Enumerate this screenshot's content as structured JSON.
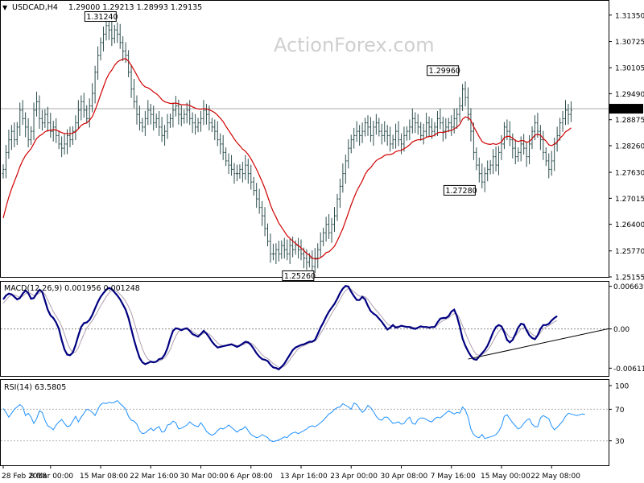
{
  "header": {
    "symbol": "USDCAD,H4",
    "ohlc": "1.29000 1.29213 1.28993 1.29135"
  },
  "watermark": "ActionForex.com",
  "price_panel": {
    "current_price_label": "1.29135",
    "current_price": 1.29135,
    "ylim": [
      1.25155,
      1.3165
    ],
    "y_ticks": [
      {
        "label": "1.31350",
        "value": 1.3135
      },
      {
        "label": "1.30725",
        "value": 1.30725
      },
      {
        "label": "1.30105",
        "value": 1.30105
      },
      {
        "label": "1.29490",
        "value": 1.2949
      },
      {
        "label": "1.28875",
        "value": 1.28875
      },
      {
        "label": "1.28260",
        "value": 1.2826
      },
      {
        "label": "1.27630",
        "value": 1.2763
      },
      {
        "label": "1.27015",
        "value": 1.27015
      },
      {
        "label": "1.26400",
        "value": 1.264
      },
      {
        "label": "1.25770",
        "value": 1.2577
      },
      {
        "label": "1.25155",
        "value": 1.25155
      }
    ],
    "annotations": [
      {
        "label": "1.31240",
        "value": 1.3124,
        "bar": 40,
        "anchor": "high"
      },
      {
        "label": "1.29960",
        "value": 1.2996,
        "bar": 163,
        "anchor": "high"
      },
      {
        "label": "1.27280",
        "value": 1.2728,
        "bar": 169,
        "anchor": "low"
      },
      {
        "label": "1.25260",
        "value": 1.2526,
        "bar": 111,
        "anchor": "low"
      }
    ],
    "close_series": [
      1.277,
      1.281,
      1.284,
      1.286,
      1.284,
      1.287,
      1.291,
      1.289,
      1.287,
      1.284,
      1.286,
      1.291,
      1.293,
      1.289,
      1.288,
      1.29,
      1.288,
      1.286,
      1.287,
      1.285,
      1.283,
      1.282,
      1.283,
      1.285,
      1.284,
      1.286,
      1.288,
      1.291,
      1.293,
      1.291,
      1.289,
      1.292,
      1.295,
      1.3,
      1.304,
      1.307,
      1.309,
      1.311,
      1.31,
      1.308,
      1.31,
      1.309,
      1.307,
      1.305,
      1.304,
      1.3,
      1.296,
      1.293,
      1.29,
      1.288,
      1.287,
      1.289,
      1.291,
      1.29,
      1.288,
      1.289,
      1.287,
      1.285,
      1.286,
      1.288,
      1.289,
      1.291,
      1.292,
      1.29,
      1.289,
      1.29,
      1.291,
      1.289,
      1.288,
      1.287,
      1.288,
      1.289,
      1.291,
      1.29,
      1.288,
      1.287,
      1.286,
      1.284,
      1.283,
      1.281,
      1.279,
      1.278,
      1.277,
      1.276,
      1.276,
      1.277,
      1.276,
      1.278,
      1.276,
      1.274,
      1.272,
      1.27,
      1.268,
      1.266,
      1.263,
      1.26,
      1.257,
      1.257,
      1.258,
      1.257,
      1.259,
      1.258,
      1.257,
      1.259,
      1.258,
      1.259,
      1.258,
      1.257,
      1.256,
      1.255,
      1.256,
      1.254,
      1.256,
      1.258,
      1.26,
      1.262,
      1.264,
      1.262,
      1.264,
      1.266,
      1.27,
      1.273,
      1.276,
      1.279,
      1.282,
      1.284,
      1.285,
      1.286,
      1.285,
      1.286,
      1.288,
      1.287,
      1.285,
      1.287,
      1.288,
      1.286,
      1.285,
      1.286,
      1.285,
      1.283,
      1.284,
      1.286,
      1.284,
      1.283,
      1.285,
      1.286,
      1.287,
      1.289,
      1.288,
      1.287,
      1.285,
      1.286,
      1.288,
      1.287,
      1.286,
      1.287,
      1.289,
      1.288,
      1.286,
      1.287,
      1.288,
      1.287,
      1.289,
      1.29,
      1.292,
      1.296,
      1.294,
      1.29,
      1.286,
      1.281,
      1.278,
      1.276,
      1.274,
      1.276,
      1.277,
      1.278,
      1.28,
      1.278,
      1.281,
      1.283,
      1.287,
      1.286,
      1.284,
      1.282,
      1.28,
      1.281,
      1.283,
      1.282,
      1.28,
      1.283,
      1.286,
      1.288,
      1.286,
      1.284,
      1.281,
      1.279,
      1.277,
      1.279,
      1.283,
      1.285,
      1.288,
      1.289,
      1.291,
      1.29,
      1.291
    ],
    "ma_series": [
      1.2655,
      1.2681,
      1.2704,
      1.2724,
      1.2741,
      1.2758,
      1.2776,
      1.2791,
      1.2803,
      1.2811,
      1.2819,
      1.2831,
      1.2843,
      1.2849,
      1.2853,
      1.2859,
      1.2862,
      1.2862,
      1.2864,
      1.2863,
      1.286,
      1.2857,
      1.2855,
      1.2855,
      1.2854,
      1.2856,
      1.2859,
      1.2866,
      1.2874,
      1.2878,
      1.288,
      1.2886,
      1.2895,
      1.291,
      1.2928,
      1.2947,
      1.2965,
      1.2983,
      1.2996,
      1.3005,
      1.3016,
      1.3024,
      1.3028,
      1.3031,
      1.3032,
      1.3026,
      1.3016,
      1.3005,
      1.2993,
      1.2981,
      1.2971,
      1.2965,
      1.2963,
      1.2959,
      1.2953,
      1.2949,
      1.2943,
      1.2935,
      1.293,
      1.2928,
      1.2926,
      1.2926,
      1.2927,
      1.2925,
      1.2923,
      1.2923,
      1.2923,
      1.2921,
      1.2918,
      1.2915,
      1.2913,
      1.2912,
      1.2914,
      1.2913,
      1.2911,
      1.2908,
      1.2904,
      1.2898,
      1.2891,
      1.2883,
      1.2872,
      1.2862,
      1.2852,
      1.2842,
      1.2833,
      1.2826,
      1.2818,
      1.2813,
      1.2805,
      1.2795,
      1.2783,
      1.277,
      1.2756,
      1.2741,
      1.2725,
      1.2706,
      1.2686,
      1.267,
      1.2657,
      1.2643,
      1.2633,
      1.2623,
      1.2613,
      1.2607,
      1.26,
      1.2595,
      1.259,
      1.2584,
      1.2578,
      1.2571,
      1.2567,
      1.256,
      1.2558,
      1.2558,
      1.2561,
      1.2566,
      1.2573,
      1.2575,
      1.2581,
      1.2588,
      1.2601,
      1.2615,
      1.263,
      1.2648,
      1.2667,
      1.2686,
      1.2703,
      1.2719,
      1.2731,
      1.2743,
      1.2758,
      1.2768,
      1.2774,
      1.2783,
      1.2791,
      1.2795,
      1.2798,
      1.2803,
      1.2805,
      1.2805,
      1.2807,
      1.2812,
      1.2814,
      1.2815,
      1.2819,
      1.2823,
      1.2828,
      1.2835,
      1.2838,
      1.284,
      1.284,
      1.2842,
      1.2846,
      1.2848,
      1.2848,
      1.2851,
      1.2856,
      1.2858,
      1.2857,
      1.2859,
      1.2861,
      1.2862,
      1.2866,
      1.287,
      1.2876,
      1.2889,
      1.2894,
      1.2893,
      1.2886,
      1.2871,
      1.2859,
      1.2847,
      1.2836,
      1.2832,
      1.283,
      1.2829,
      1.2831,
      1.2829,
      1.2831,
      1.2835,
      1.2845,
      1.2848,
      1.2848,
      1.2844,
      1.2838,
      1.2836,
      1.2838,
      1.2838,
      1.2834,
      1.2836,
      1.2843,
      1.2851,
      1.2853,
      1.2851,
      1.2843,
      1.2837,
      1.2828,
      1.2826,
      1.283,
      1.2835,
      1.2844,
      1.285,
      1.2859,
      1.2863,
      1.2868
    ]
  },
  "macd_panel": {
    "label": "MACD(12,26,9) 0.001956 0.001248",
    "ylim": [
      -0.0072,
      0.0071
    ],
    "y_ticks": [
      {
        "label": "0.006639",
        "value": 0.006639
      },
      {
        "label": "0.00",
        "value": 0.0
      },
      {
        "label": "-0.006114",
        "value": -0.006114
      }
    ],
    "macd_series": [
      0.0046,
      0.0052,
      0.0055,
      0.0054,
      0.005,
      0.0046,
      0.0048,
      0.0055,
      0.006,
      0.0056,
      0.0047,
      0.0048,
      0.0055,
      0.0061,
      0.0058,
      0.0044,
      0.003,
      0.0021,
      0.0017,
      0.001,
      0.0,
      -0.0017,
      -0.0032,
      -0.004,
      -0.0041,
      -0.0037,
      -0.0025,
      -0.001,
      0.0003,
      0.0009,
      0.001,
      0.0014,
      0.0022,
      0.0032,
      0.0042,
      0.005,
      0.0056,
      0.0061,
      0.0064,
      0.0062,
      0.0057,
      0.0052,
      0.0046,
      0.0038,
      0.003,
      0.0017,
      0.0,
      -0.0017,
      -0.0032,
      -0.0045,
      -0.0052,
      -0.0055,
      -0.0053,
      -0.0051,
      -0.0052,
      -0.0051,
      -0.0047,
      -0.0046,
      -0.004,
      -0.003,
      -0.0015,
      -0.0003,
      0.0001,
      0.0,
      -0.0002,
      0.0,
      0.0001,
      -0.0003,
      -0.0008,
      -0.001,
      -0.0012,
      -0.0008,
      -0.0003,
      -0.0007,
      -0.0013,
      -0.002,
      -0.0025,
      -0.0029,
      -0.0028,
      -0.0027,
      -0.0026,
      -0.0025,
      -0.0024,
      -0.0026,
      -0.0028,
      -0.0026,
      -0.0023,
      -0.002,
      -0.0021,
      -0.0025,
      -0.0031,
      -0.0038,
      -0.0043,
      -0.0047,
      -0.0048,
      -0.005,
      -0.0056,
      -0.006,
      -0.0061,
      -0.0063,
      -0.0059,
      -0.0054,
      -0.0047,
      -0.004,
      -0.0033,
      -0.0029,
      -0.0027,
      -0.0025,
      -0.0024,
      -0.0022,
      -0.002,
      -0.002,
      -0.0017,
      -0.0008,
      0.0002,
      0.001,
      0.0019,
      0.0027,
      0.0033,
      0.0039,
      0.0047,
      0.0056,
      0.0063,
      0.0067,
      0.0066,
      0.0058,
      0.0051,
      0.0045,
      0.0045,
      0.005,
      0.0046,
      0.0036,
      0.0028,
      0.0024,
      0.0021,
      0.0016,
      0.0011,
      0.0005,
      -0.0001,
      0.0002,
      0.0006,
      0.0002,
      0.0003,
      0.0005,
      0.0004,
      0.0003,
      0.0003,
      0.0001,
      0.0,
      0.0002,
      0.0004,
      0.0003,
      0.0003,
      0.0002,
      0.0003,
      0.0003,
      0.001,
      0.0016,
      0.0017,
      0.0017,
      0.002,
      0.0027,
      0.003,
      0.002,
      0.0004,
      -0.0015,
      -0.0026,
      -0.0035,
      -0.0042,
      -0.0047,
      -0.0048,
      -0.0043,
      -0.0038,
      -0.0033,
      -0.0026,
      -0.0016,
      -0.0005,
      0.0003,
      0.0006,
      0.0004,
      -0.0005,
      -0.0017,
      -0.0021,
      -0.0017,
      -0.0008,
      0.0002,
      0.0008,
      0.0007,
      -0.0002,
      -0.001,
      -0.0014,
      -0.0016,
      -0.001,
      0.0,
      0.0006,
      0.0006,
      0.0008,
      0.0013,
      0.0017,
      0.002
    ],
    "signal_series": [
      0.004,
      0.0045,
      0.005,
      0.0053,
      0.0053,
      0.0051,
      0.0049,
      0.0051,
      0.0055,
      0.0057,
      0.0055,
      0.0052,
      0.0053,
      0.0056,
      0.0058,
      0.0054,
      0.0045,
      0.0036,
      0.0027,
      0.002,
      0.0013,
      0.0004,
      -0.0008,
      -0.0021,
      -0.0031,
      -0.0037,
      -0.0036,
      -0.0029,
      -0.0018,
      -0.0008,
      0.0001,
      0.0007,
      0.0013,
      0.002,
      0.0028,
      0.0036,
      0.0043,
      0.005,
      0.0056,
      0.006,
      0.006,
      0.0058,
      0.0054,
      0.0049,
      0.0043,
      0.0035,
      0.0025,
      0.0011,
      -0.0004,
      -0.0018,
      -0.0031,
      -0.0041,
      -0.0047,
      -0.005,
      -0.0051,
      -0.0051,
      -0.005,
      -0.0048,
      -0.0045,
      -0.004,
      -0.0032,
      -0.0021,
      -0.0011,
      -0.0004,
      -0.0001,
      0.0,
      0.0,
      -0.0001,
      -0.0004,
      -0.0007,
      -0.0009,
      -0.0009,
      -0.0007,
      -0.0006,
      -0.0008,
      -0.0012,
      -0.0017,
      -0.0022,
      -0.0025,
      -0.0026,
      -0.0026,
      -0.0026,
      -0.0025,
      -0.0025,
      -0.0026,
      -0.0026,
      -0.0025,
      -0.0023,
      -0.0022,
      -0.0022,
      -0.0025,
      -0.003,
      -0.0035,
      -0.004,
      -0.0044,
      -0.0046,
      -0.005,
      -0.0054,
      -0.0057,
      -0.006,
      -0.006,
      -0.0058,
      -0.0054,
      -0.0048,
      -0.0042,
      -0.0036,
      -0.0031,
      -0.0028,
      -0.0026,
      -0.0024,
      -0.0022,
      -0.0021,
      -0.0019,
      -0.0014,
      -0.0007,
      0.0,
      0.0008,
      0.0016,
      0.0024,
      0.0031,
      0.0038,
      0.0046,
      0.0054,
      0.006,
      0.0063,
      0.0062,
      0.0058,
      0.0054,
      0.0051,
      0.0051,
      0.005,
      0.0046,
      0.004,
      0.0034,
      0.0029,
      0.0024,
      0.0019,
      0.0013,
      0.0008,
      0.0005,
      0.0005,
      0.0004,
      0.0004,
      0.0004,
      0.0004,
      0.0004,
      0.0004,
      0.0003,
      0.0002,
      0.0002,
      0.0003,
      0.0003,
      0.0003,
      0.0003,
      0.0003,
      0.0003,
      0.0006,
      0.001,
      0.0013,
      0.0015,
      0.0017,
      0.0021,
      0.0024,
      0.0023,
      0.0016,
      0.0005,
      -0.0006,
      -0.0016,
      -0.0026,
      -0.0034,
      -0.004,
      -0.0041,
      -0.004,
      -0.0037,
      -0.0033,
      -0.0027,
      -0.0019,
      -0.0011,
      -0.0004,
      0.0,
      -0.0002,
      -0.0008,
      -0.0013,
      -0.0014,
      -0.0011,
      -0.0006,
      0.0,
      0.0002,
      0.0,
      -0.0004,
      -0.0008,
      -0.0011,
      -0.0011,
      -0.0006,
      0.0,
      0.0003,
      0.0005,
      0.0008,
      0.0011,
      0.0013
    ],
    "trendline": {
      "from": {
        "bar": 167,
        "value": -0.0047
      },
      "to": {
        "bar": 214,
        "value": -0.0003
      }
    }
  },
  "rsi_panel": {
    "label": "RSI(14) 63.5805",
    "ylim": [
      0,
      100
    ],
    "y_ticks": [
      {
        "label": "100",
        "value": 100
      },
      {
        "label": "70",
        "value": 70
      },
      {
        "label": "30",
        "value": 30
      },
      {
        "label": "0",
        "value": 0
      }
    ],
    "series": [
      71,
      66,
      60,
      65,
      70,
      73,
      76,
      73,
      62,
      65,
      60,
      52,
      58,
      68,
      66,
      56,
      49,
      47,
      44,
      50,
      54,
      57,
      52,
      48,
      49,
      55,
      61,
      54,
      60,
      65,
      70,
      69,
      66,
      62,
      70,
      76,
      78,
      77,
      79,
      78,
      79,
      81,
      77,
      74,
      70,
      61,
      56,
      55,
      51,
      43,
      39,
      40,
      43,
      46,
      43,
      46,
      48,
      41,
      42,
      50,
      51,
      55,
      53,
      45,
      46,
      48,
      50,
      54,
      51,
      49,
      48,
      53,
      48,
      42,
      39,
      37,
      39,
      43,
      46,
      45,
      47,
      50,
      47,
      44,
      41,
      44,
      45,
      48,
      43,
      38,
      36,
      34,
      35,
      38,
      36,
      34,
      30,
      29,
      30,
      31,
      33,
      35,
      34,
      38,
      40,
      41,
      39,
      41,
      43,
      45,
      48,
      49,
      48,
      50,
      53,
      56,
      60,
      64,
      66,
      70,
      72,
      73,
      77,
      75,
      73,
      70,
      78,
      76,
      71,
      66,
      69,
      75,
      72,
      67,
      61,
      57,
      56,
      60,
      60,
      56,
      52,
      53,
      54,
      51,
      52,
      57,
      60,
      52,
      51,
      57,
      59,
      59,
      57,
      55,
      54,
      58,
      60,
      59,
      62,
      65,
      68,
      66,
      64,
      66,
      65,
      73,
      69,
      60,
      45,
      38,
      35,
      34,
      38,
      33,
      34,
      35,
      36,
      38,
      42,
      49,
      61,
      63,
      58,
      53,
      49,
      45,
      47,
      52,
      56,
      58,
      51,
      48,
      48,
      59,
      62,
      60,
      58,
      49,
      44,
      47,
      51,
      55,
      61,
      65,
      64,
      63,
      62,
      63,
      64,
      63.58
    ]
  },
  "x_axis": {
    "bars": 215,
    "labels": [
      {
        "label": "28 Feb 2018",
        "bar": 0
      },
      {
        "label": "8 Mar 00:00",
        "bar": 17
      },
      {
        "label": "15 Mar 08:00",
        "bar": 35
      },
      {
        "label": "22 Mar 16:00",
        "bar": 53
      },
      {
        "label": "30 Mar 00:00",
        "bar": 71
      },
      {
        "label": "6 Apr 08:00",
        "bar": 89
      },
      {
        "label": "13 Apr 16:00",
        "bar": 107
      },
      {
        "label": "23 Apr 00:00",
        "bar": 125
      },
      {
        "label": "30 Apr 08:00",
        "bar": 143
      },
      {
        "label": "7 May 16:00",
        "bar": 161
      },
      {
        "label": "15 May 00:00",
        "bar": 179
      },
      {
        "label": "22 May 08:00",
        "bar": 197
      }
    ]
  },
  "colors": {
    "price_bars": "#2f4f4f",
    "moving_average": "#d00000",
    "macd_line": "#000080",
    "signal_line": "#b0a0b0",
    "rsi_line": "#1e90ff",
    "grid_dots": "#888888"
  }
}
